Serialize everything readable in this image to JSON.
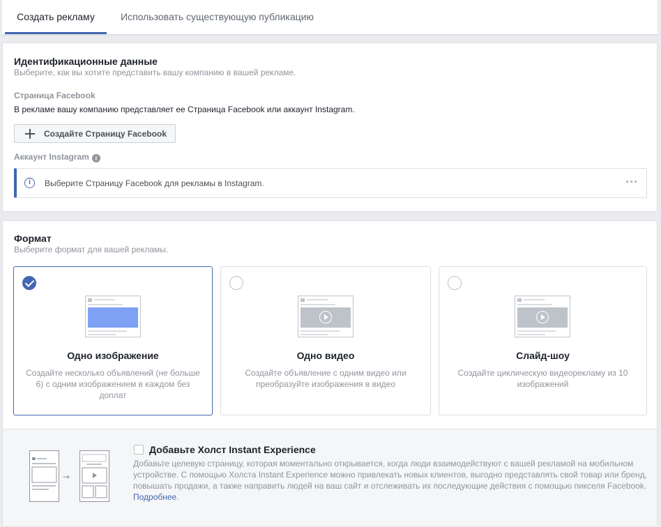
{
  "tabs": [
    {
      "label": "Создать рекламу",
      "active": true
    },
    {
      "label": "Использовать существующую публикацию",
      "active": false
    }
  ],
  "identity": {
    "title": "Идентификационные данные",
    "subtitle": "Выберите, как вы хотите представить вашу компанию в вашей рекламе.",
    "facebook_label": "Страница Facebook",
    "facebook_desc": "В рекламе вашу компанию представляет ее Страница Facebook или аккаунт Instagram.",
    "create_page_button": "Создайте Страницу Facebook",
    "instagram_label": "Аккаунт Instagram",
    "instagram_notice": "Выберите Страницу Facebook для рекламы в Instagram.",
    "more_dots": "•••"
  },
  "format": {
    "title": "Формат",
    "subtitle": "Выберите формат для вашей рекламы.",
    "options": [
      {
        "title": "Одно изображение",
        "desc": "Создайте несколько объявлений (не больше 6) с одним изображением в каждом без доплат",
        "selected": true
      },
      {
        "title": "Одно видео",
        "desc": "Создайте объявление с одним видео или преобразуйте изображения в видео",
        "selected": false
      },
      {
        "title": "Слайд-шоу",
        "desc": "Создайте циклическую видеорекламу из 10 изображений",
        "selected": false
      }
    ],
    "instant_experience": {
      "title": "Добавьте Холст Instant Experience",
      "desc": "Добавьте целевую страницу, которая моментально открывается, когда люди взаимодействуют с вашей рекламой на мобильном устройстве. С помощью Холста Instant Experience можно привлекать новых клиентов, выгодно представлять свой товар или бренд, повышать продажи, а также направить людей на ваш сайт и отслеживать их последующие действия с помощью пикселя Facebook.",
      "link": "Подробнее",
      "arrow": "→",
      "checked": false
    }
  },
  "colors": {
    "accent": "#4267b2",
    "selected_media": "#7ea1f6",
    "muted_text": "#90949c"
  }
}
